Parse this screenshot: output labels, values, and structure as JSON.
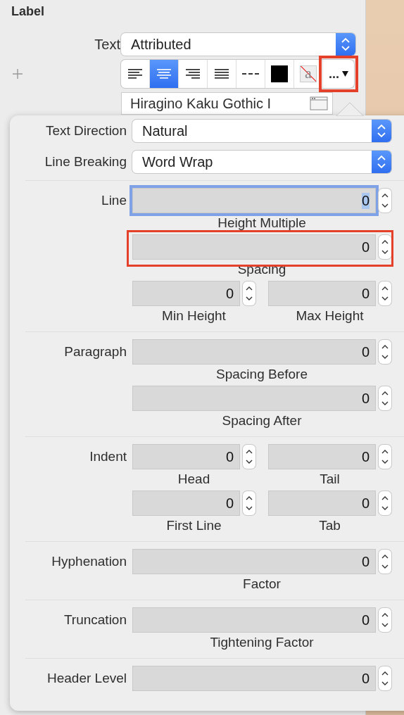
{
  "inspector": {
    "title": "Label",
    "text_type": {
      "label": "Text",
      "value": "Attributed"
    },
    "toolbar": [
      {
        "kind": "align-left",
        "selected": false
      },
      {
        "kind": "align-center",
        "selected": true
      },
      {
        "kind": "align-right",
        "selected": false
      },
      {
        "kind": "align-justify",
        "selected": false
      },
      {
        "kind": "align-natural",
        "selected": false
      },
      {
        "kind": "color-swatch",
        "selected": false
      },
      {
        "kind": "background",
        "text": "a",
        "selected": false
      },
      {
        "kind": "more",
        "text": "...",
        "selected": false,
        "highlighted": true
      }
    ],
    "font_field": {
      "value": "Hiragino Kaku Gothic I"
    }
  },
  "popover": {
    "popups": [
      {
        "label": "Text Direction",
        "value": "Natural"
      },
      {
        "label": "Line Breaking",
        "value": "Word Wrap"
      }
    ],
    "sections": [
      {
        "label": "Line",
        "rows": [
          [
            {
              "value": "0",
              "caption": "Height Multiple",
              "focused": true,
              "highlighted": false
            }
          ],
          [
            {
              "value": "0",
              "caption": "Spacing",
              "focused": false,
              "highlighted": true
            }
          ],
          [
            {
              "value": "0",
              "caption": "Min Height",
              "focused": false,
              "highlighted": false
            },
            {
              "value": "0",
              "caption": "Max Height",
              "focused": false,
              "highlighted": false
            }
          ]
        ]
      },
      {
        "label": "Paragraph",
        "rows": [
          [
            {
              "value": "0",
              "caption": "Spacing Before",
              "focused": false,
              "highlighted": false
            }
          ],
          [
            {
              "value": "0",
              "caption": "Spacing After",
              "focused": false,
              "highlighted": false
            }
          ]
        ]
      },
      {
        "label": "Indent",
        "rows": [
          [
            {
              "value": "0",
              "caption": "Head",
              "focused": false,
              "highlighted": false
            },
            {
              "value": "0",
              "caption": "Tail",
              "focused": false,
              "highlighted": false
            }
          ],
          [
            {
              "value": "0",
              "caption": "First Line",
              "focused": false,
              "highlighted": false
            },
            {
              "value": "0",
              "caption": "Tab",
              "focused": false,
              "highlighted": false
            }
          ]
        ]
      },
      {
        "label": "Hyphenation",
        "rows": [
          [
            {
              "value": "0",
              "caption": "Factor",
              "focused": false,
              "highlighted": false
            }
          ]
        ]
      },
      {
        "label": "Truncation",
        "rows": [
          [
            {
              "value": "0",
              "caption": "Tightening Factor",
              "focused": false,
              "highlighted": false
            }
          ]
        ]
      },
      {
        "label": "Header Level",
        "rows": [
          [
            {
              "value": "0",
              "focused": false,
              "highlighted": false
            }
          ]
        ]
      }
    ]
  }
}
